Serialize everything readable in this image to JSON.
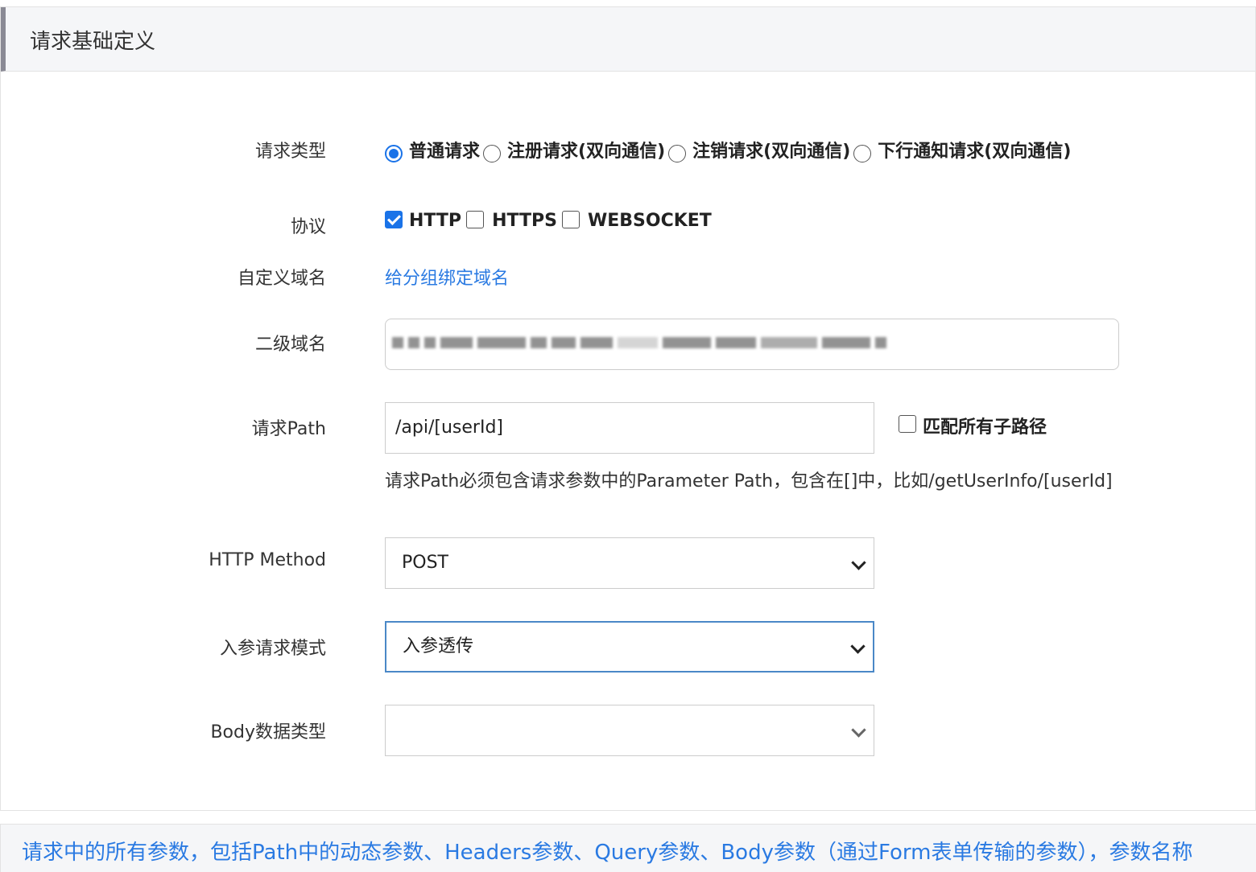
{
  "panel": {
    "title": "请求基础定义"
  },
  "labels": {
    "request_type": "请求类型",
    "protocol": "协议",
    "custom_domain": "自定义域名",
    "subdomain": "二级域名",
    "request_path": "请求Path",
    "http_method": "HTTP Method",
    "param_mode": "入参请求模式",
    "body_type": "Body数据类型"
  },
  "request_types": [
    {
      "label": "普通请求",
      "checked": true
    },
    {
      "label": "注册请求(双向通信)",
      "checked": false
    },
    {
      "label": "注销请求(双向通信)",
      "checked": false
    },
    {
      "label": "下行通知请求(双向通信)",
      "checked": false
    }
  ],
  "protocols": [
    {
      "label": "HTTP",
      "checked": true
    },
    {
      "label": "HTTPS",
      "checked": false
    },
    {
      "label": "WEBSOCKET",
      "checked": false
    }
  ],
  "custom_domain_link": "给分组绑定域名",
  "path": {
    "value": "/api/[userId]",
    "match_sub_paths_label": "匹配所有子路径",
    "help": "请求Path必须包含请求参数中的Parameter Path，包含在[]中，比如/getUserInfo/[userId]"
  },
  "http_method": {
    "selected": "POST"
  },
  "param_mode": {
    "selected": "入参透传"
  },
  "body_type": {
    "selected": ""
  },
  "footer_notice": "请求中的所有参数，包括Path中的动态参数、Headers参数、Query参数、Body参数（通过Form表单传输的参数），参数名称"
}
